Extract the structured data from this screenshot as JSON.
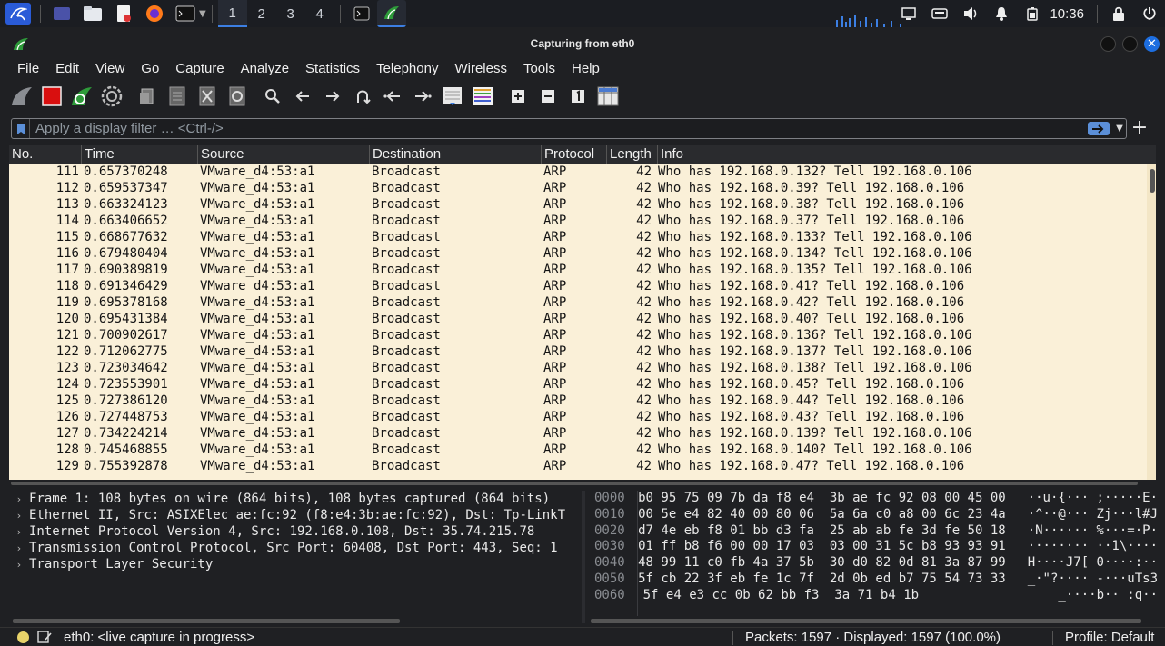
{
  "taskbar": {
    "workspaces": [
      "1",
      "2",
      "3",
      "4"
    ],
    "active_workspace": 0,
    "clock": "10:36"
  },
  "window": {
    "title": "Capturing from eth0"
  },
  "menu": [
    "File",
    "Edit",
    "View",
    "Go",
    "Capture",
    "Analyze",
    "Statistics",
    "Telephony",
    "Wireless",
    "Tools",
    "Help"
  ],
  "filter": {
    "placeholder": "Apply a display filter … <Ctrl-/>",
    "value": ""
  },
  "packet_list": {
    "columns": [
      "No.",
      "Time",
      "Source",
      "Destination",
      "Protocol",
      "Length",
      "Info"
    ],
    "rows": [
      {
        "no": "111",
        "time": "0.657370248",
        "src": "VMware_d4:53:a1",
        "dst": "Broadcast",
        "proto": "ARP",
        "len": "42",
        "info": "Who has 192.168.0.132? Tell 192.168.0.106"
      },
      {
        "no": "112",
        "time": "0.659537347",
        "src": "VMware_d4:53:a1",
        "dst": "Broadcast",
        "proto": "ARP",
        "len": "42",
        "info": "Who has 192.168.0.39? Tell 192.168.0.106"
      },
      {
        "no": "113",
        "time": "0.663324123",
        "src": "VMware_d4:53:a1",
        "dst": "Broadcast",
        "proto": "ARP",
        "len": "42",
        "info": "Who has 192.168.0.38? Tell 192.168.0.106"
      },
      {
        "no": "114",
        "time": "0.663406652",
        "src": "VMware_d4:53:a1",
        "dst": "Broadcast",
        "proto": "ARP",
        "len": "42",
        "info": "Who has 192.168.0.37? Tell 192.168.0.106"
      },
      {
        "no": "115",
        "time": "0.668677632",
        "src": "VMware_d4:53:a1",
        "dst": "Broadcast",
        "proto": "ARP",
        "len": "42",
        "info": "Who has 192.168.0.133? Tell 192.168.0.106"
      },
      {
        "no": "116",
        "time": "0.679480404",
        "src": "VMware_d4:53:a1",
        "dst": "Broadcast",
        "proto": "ARP",
        "len": "42",
        "info": "Who has 192.168.0.134? Tell 192.168.0.106"
      },
      {
        "no": "117",
        "time": "0.690389819",
        "src": "VMware_d4:53:a1",
        "dst": "Broadcast",
        "proto": "ARP",
        "len": "42",
        "info": "Who has 192.168.0.135? Tell 192.168.0.106"
      },
      {
        "no": "118",
        "time": "0.691346429",
        "src": "VMware_d4:53:a1",
        "dst": "Broadcast",
        "proto": "ARP",
        "len": "42",
        "info": "Who has 192.168.0.41? Tell 192.168.0.106"
      },
      {
        "no": "119",
        "time": "0.695378168",
        "src": "VMware_d4:53:a1",
        "dst": "Broadcast",
        "proto": "ARP",
        "len": "42",
        "info": "Who has 192.168.0.42? Tell 192.168.0.106"
      },
      {
        "no": "120",
        "time": "0.695431384",
        "src": "VMware_d4:53:a1",
        "dst": "Broadcast",
        "proto": "ARP",
        "len": "42",
        "info": "Who has 192.168.0.40? Tell 192.168.0.106"
      },
      {
        "no": "121",
        "time": "0.700902617",
        "src": "VMware_d4:53:a1",
        "dst": "Broadcast",
        "proto": "ARP",
        "len": "42",
        "info": "Who has 192.168.0.136? Tell 192.168.0.106"
      },
      {
        "no": "122",
        "time": "0.712062775",
        "src": "VMware_d4:53:a1",
        "dst": "Broadcast",
        "proto": "ARP",
        "len": "42",
        "info": "Who has 192.168.0.137? Tell 192.168.0.106"
      },
      {
        "no": "123",
        "time": "0.723034642",
        "src": "VMware_d4:53:a1",
        "dst": "Broadcast",
        "proto": "ARP",
        "len": "42",
        "info": "Who has 192.168.0.138? Tell 192.168.0.106"
      },
      {
        "no": "124",
        "time": "0.723553901",
        "src": "VMware_d4:53:a1",
        "dst": "Broadcast",
        "proto": "ARP",
        "len": "42",
        "info": "Who has 192.168.0.45? Tell 192.168.0.106"
      },
      {
        "no": "125",
        "time": "0.727386120",
        "src": "VMware_d4:53:a1",
        "dst": "Broadcast",
        "proto": "ARP",
        "len": "42",
        "info": "Who has 192.168.0.44? Tell 192.168.0.106"
      },
      {
        "no": "126",
        "time": "0.727448753",
        "src": "VMware_d4:53:a1",
        "dst": "Broadcast",
        "proto": "ARP",
        "len": "42",
        "info": "Who has 192.168.0.43? Tell 192.168.0.106"
      },
      {
        "no": "127",
        "time": "0.734224214",
        "src": "VMware_d4:53:a1",
        "dst": "Broadcast",
        "proto": "ARP",
        "len": "42",
        "info": "Who has 192.168.0.139? Tell 192.168.0.106"
      },
      {
        "no": "128",
        "time": "0.745468855",
        "src": "VMware_d4:53:a1",
        "dst": "Broadcast",
        "proto": "ARP",
        "len": "42",
        "info": "Who has 192.168.0.140? Tell 192.168.0.106"
      },
      {
        "no": "129",
        "time": "0.755392878",
        "src": "VMware_d4:53:a1",
        "dst": "Broadcast",
        "proto": "ARP",
        "len": "42",
        "info": "Who has 192.168.0.47? Tell 192.168.0.106"
      }
    ]
  },
  "details": [
    "Frame 1: 108 bytes on wire (864 bits), 108 bytes captured (864 bits)",
    "Ethernet II, Src: ASIXElec_ae:fc:92 (f8:e4:3b:ae:fc:92), Dst: Tp-LinkT",
    "Internet Protocol Version 4, Src: 192.168.0.108, Dst: 35.74.215.78",
    "Transmission Control Protocol, Src Port: 60408, Dst Port: 443, Seq: 1",
    "Transport Layer Security"
  ],
  "bytes": [
    {
      "off": "0000",
      "hex": "b0 95 75 09 7b da f8 e4  3b ae fc 92 08 00 45 00",
      "ascii": "··u·{··· ;·····E·"
    },
    {
      "off": "0010",
      "hex": "00 5e e4 82 40 00 80 06  5a 6a c0 a8 00 6c 23 4a",
      "ascii": "·^··@··· Zj···l#J"
    },
    {
      "off": "0020",
      "hex": "d7 4e eb f8 01 bb d3 fa  25 ab ab fe 3d fe 50 18",
      "ascii": "·N······ %···=·P·"
    },
    {
      "off": "0030",
      "hex": "01 ff b8 f6 00 00 17 03  03 00 31 5c b8 93 93 91",
      "ascii": "········ ··1\\····"
    },
    {
      "off": "0040",
      "hex": "48 99 11 c0 fb 4a 37 5b  30 d0 82 0d 81 3a 87 99",
      "ascii": "H····J7[ 0····:··"
    },
    {
      "off": "0050",
      "hex": "5f cb 22 3f eb fe 1c 7f  2d 0b ed b7 75 54 73 33",
      "ascii": "_·\"?···· -···uTs3"
    },
    {
      "off": "0060",
      "hex": "5f e4 e3 cc 0b 62 bb f3  3a 71 b4 1b",
      "ascii": "_····b·· :q··"
    }
  ],
  "status": {
    "capture": "eth0: <live capture in progress>",
    "packets": "Packets: 1597 · Displayed: 1597 (100.0%)",
    "profile": "Profile: Default"
  },
  "colors": {
    "row_bg": "#faf0d8",
    "accent": "#3c7fe3",
    "shark_fin": "#2e9b3a"
  }
}
